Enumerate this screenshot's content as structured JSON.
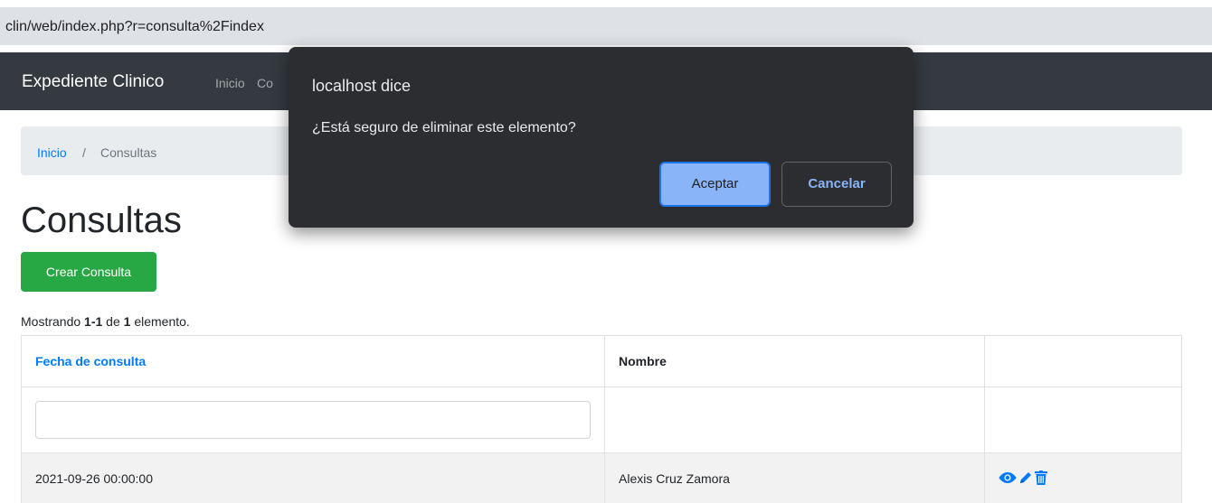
{
  "browser": {
    "url": "clin/web/index.php?r=consulta%2Findex"
  },
  "navbar": {
    "brand": "Expediente Clinico",
    "links": [
      {
        "label": "Inicio"
      },
      {
        "label": "Co"
      }
    ]
  },
  "breadcrumb": {
    "home": "Inicio",
    "separator": "/",
    "current": "Consultas"
  },
  "page": {
    "title": "Consultas",
    "create_button": "Crear Consulta",
    "summary": {
      "prefix": "Mostrando ",
      "range": "1-1",
      "middle": " de ",
      "total": "1",
      "suffix": " elemento."
    }
  },
  "table": {
    "headers": [
      "Fecha de consulta",
      "Nombre",
      ""
    ],
    "filter": {
      "value": "",
      "placeholder": ""
    },
    "rows": [
      {
        "fecha": "2021-09-26 00:00:00",
        "nombre": "Alexis Cruz Zamora",
        "actions": [
          "eye-icon",
          "pencil-icon",
          "trash-icon"
        ]
      }
    ]
  },
  "dialog": {
    "title": "localhost dice",
    "message": "¿Está seguro de eliminar este elemento?",
    "ok_label": "Aceptar",
    "cancel_label": "Cancelar"
  },
  "colors": {
    "primary": "#007bff",
    "success": "#28a745",
    "dialog_bg": "#2b2d31",
    "dialog_accent": "#8ab4f8",
    "navbar": "#343a40"
  }
}
